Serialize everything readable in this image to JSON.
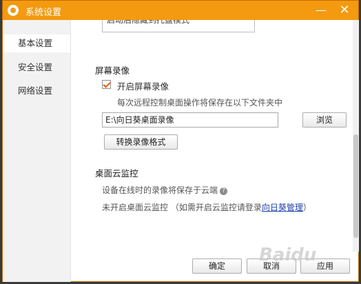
{
  "window": {
    "title": "系统设置",
    "minimize_glyph": "—",
    "close_glyph": "✕"
  },
  "sidebar": {
    "items": [
      {
        "label": "基本设置",
        "active": true
      },
      {
        "label": "安全设置",
        "active": false
      },
      {
        "label": "网络设置",
        "active": false
      }
    ]
  },
  "content": {
    "clipped_option_text": "启动后隐藏到托盘模式",
    "screen_recording": {
      "title": "屏幕录像",
      "enable_label": "开启屏幕录像",
      "enabled": true,
      "description": "每次远程控制桌面操作将保存在以下文件夹中",
      "path_value": "E:\\向日葵桌面录像",
      "browse_label": "浏览",
      "convert_label": "转换录像格式"
    },
    "desktop_cloud": {
      "title": "桌面云监控",
      "save_note": "设备在线时的录像将保存于云端",
      "status_prefix": "未开启桌面云监控 （如需开启云监控请登录",
      "link_text": "向日葵管理",
      "status_suffix": "）"
    }
  },
  "footer": {
    "ok_label": "确定",
    "cancel_label": "取消",
    "apply_label": "应用"
  },
  "watermark": "Baidu"
}
